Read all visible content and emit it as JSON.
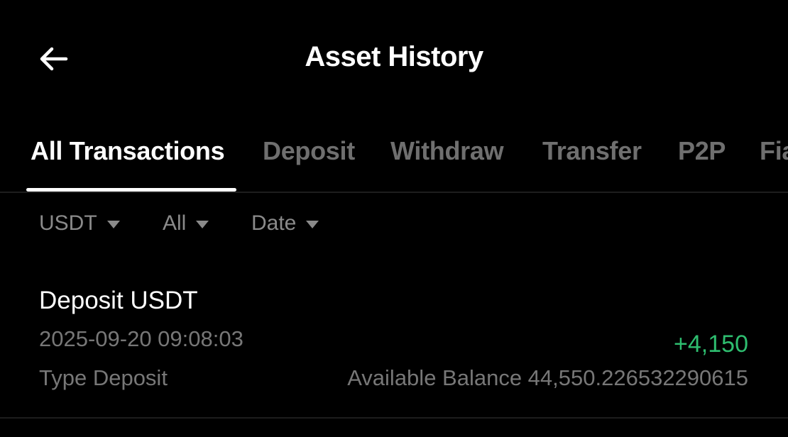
{
  "header": {
    "title": "Asset History",
    "back_icon": "arrow-left-icon"
  },
  "tabs": [
    {
      "label": "All Transactions",
      "active": true
    },
    {
      "label": "Deposit",
      "active": false
    },
    {
      "label": "Withdraw",
      "active": false
    },
    {
      "label": "Transfer",
      "active": false
    },
    {
      "label": "P2P",
      "active": false
    },
    {
      "label": "Fia",
      "active": false
    }
  ],
  "filters": [
    {
      "label": "USDT",
      "icon": "caret-down-icon"
    },
    {
      "label": "All",
      "icon": "caret-down-icon"
    },
    {
      "label": "Date",
      "icon": "caret-down-icon"
    }
  ],
  "transactions": [
    {
      "title": "Deposit USDT",
      "datetime": "2025-09-20 09:08:03",
      "type": "Type Deposit",
      "amount": "+4,150",
      "balance": "Available Balance 44,550.226532290615"
    }
  ],
  "colors": {
    "background": "#000000",
    "active_text": "#ffffff",
    "inactive_tab": "#6f6f6f",
    "muted_text": "#777777",
    "positive_amount": "#2ebd6f"
  }
}
